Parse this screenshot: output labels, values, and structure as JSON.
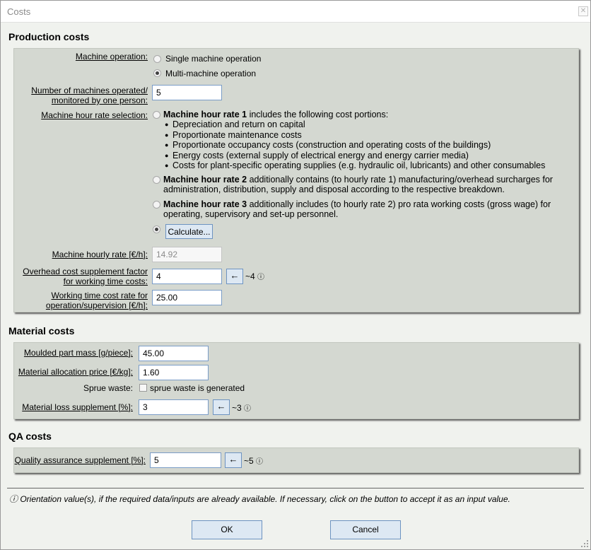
{
  "window": {
    "title": "Costs",
    "close_glyph": "✕"
  },
  "production": {
    "title": "Production costs",
    "machine_operation_label": "Machine operation:",
    "single_label": "Single machine operation",
    "multi_label": "Multi-machine operation",
    "machines_label_1": "Number of machines operated/",
    "machines_label_2": "monitored by one person:",
    "machines_value": "5",
    "rate_selection_label": "Machine hour rate selection:",
    "rate1_bold": "Machine hour rate 1",
    "rate1_text": " includes the following cost portions:",
    "rate1_bullets": [
      "Depreciation and return on capital",
      "Proportionate maintenance costs",
      "Proportionate occupancy costs (construction and operating costs of the buildings)",
      "Energy costs (external supply of electrical energy and energy carrier media)",
      "Costs for plant-specific operating supplies (e.g. hydraulic oil, lubricants) and other consumables"
    ],
    "rate2_bold": "Machine hour rate 2",
    "rate2_text_1": " additionally contains (to hourly rate 1) manufacturing/overhead surcharges for",
    "rate2_text_2": "administration, distribution, supply and disposal according to the respective breakdown.",
    "rate3_bold": "Machine hour rate 3",
    "rate3_text_1": " additionally includes (to hourly rate 2) pro rata working costs (gross wage) for",
    "rate3_text_2": "operating, supervisory and set-up personnel.",
    "calculate_label": "Calculate...",
    "hourly_rate_label": "Machine hourly rate [€/h]:",
    "hourly_rate_value": "14.92",
    "overhead_label_1": "Overhead cost supplement factor",
    "overhead_label_2": "for working time costs:",
    "overhead_value": "4",
    "overhead_hint": "~4",
    "working_label_1": "Working time cost rate for",
    "working_label_2": "operation/supervision [€/h]:",
    "working_value": "25.00"
  },
  "material": {
    "title": "Material costs",
    "mass_label": "Moulded part mass [g/piece]:",
    "mass_value": "45.00",
    "price_label": "Material allocation price [€/kg]:",
    "price_value": "1.60",
    "sprue_label": "Sprue waste:",
    "sprue_checkbox_label": "sprue waste is generated",
    "loss_label": "Material loss supplement [%]:",
    "loss_value": "3",
    "loss_hint": "~3"
  },
  "qa": {
    "title": "QA costs",
    "qa_label": "Quality assurance supplement [%]:",
    "qa_value": "5",
    "qa_hint": "~5"
  },
  "footer": {
    "note": "ⓘ Orientation value(s), if the required data/inputs are already available. If necessary, click on the button to accept it as an input value.",
    "ok_label": "OK",
    "cancel_label": "Cancel"
  },
  "glyphs": {
    "arrow": "←",
    "info": "ⓘ"
  },
  "colors": {
    "group_bg": "#d4d8d1",
    "button_bg": "#dde8f3",
    "button_border": "#6d93c1",
    "dialog_bg": "#f0f2ee"
  }
}
